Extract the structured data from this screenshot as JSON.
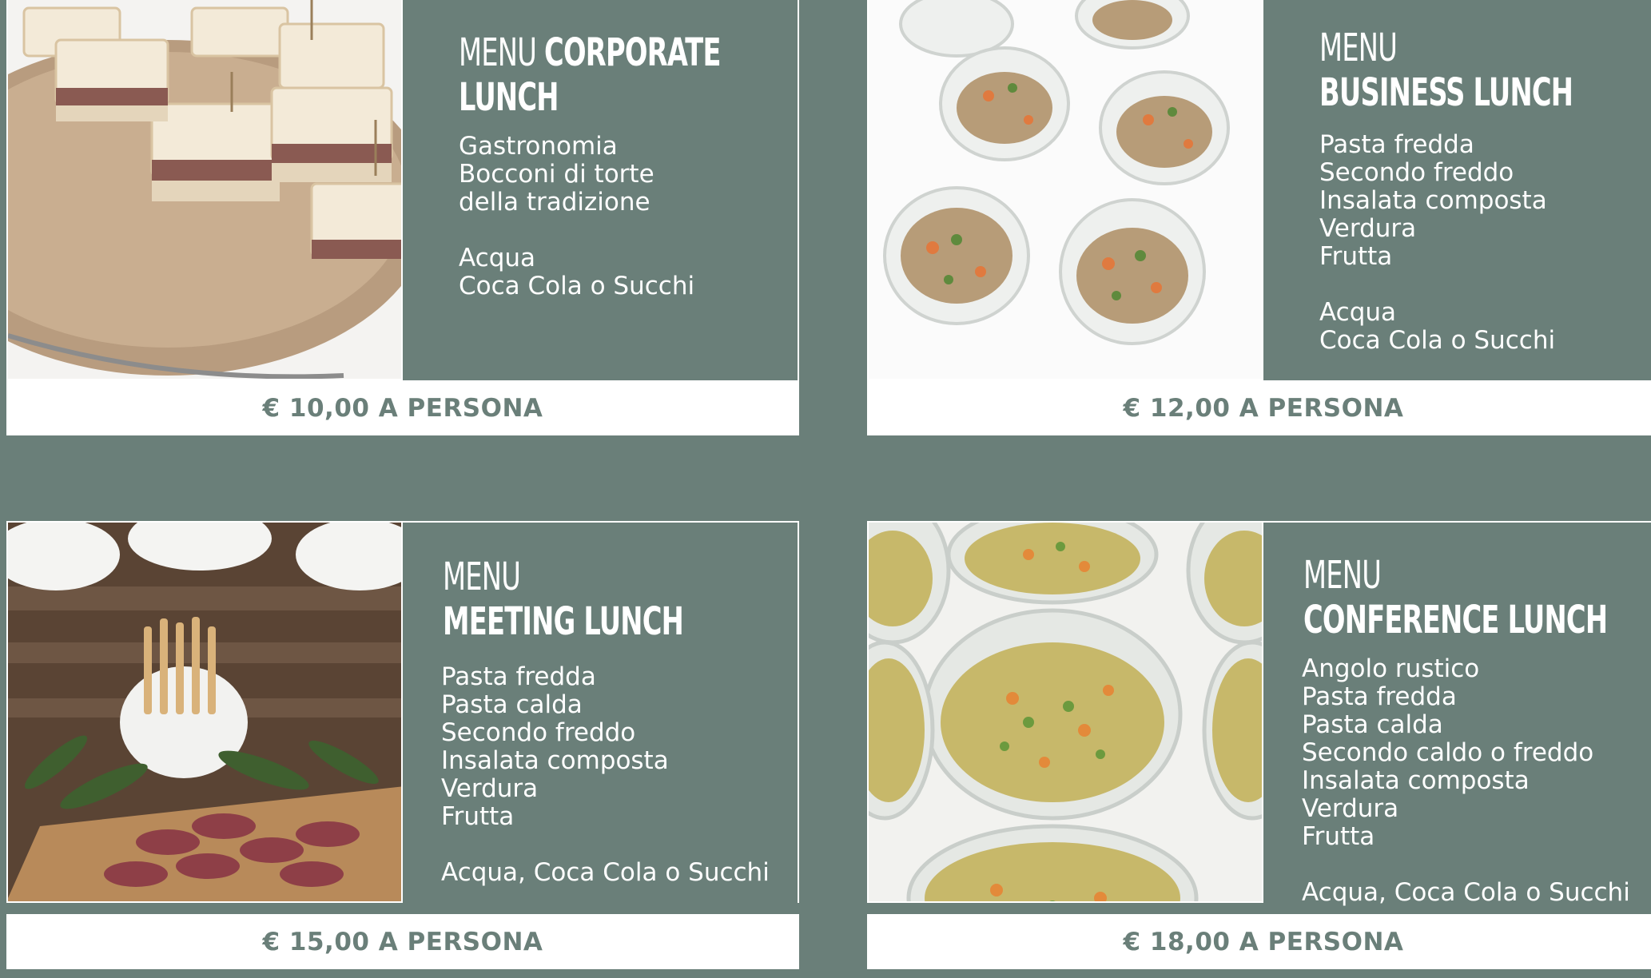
{
  "menus": [
    {
      "title_light": "MENU",
      "title_bold": "CORPORATE",
      "title_bold_2": "LUNCH",
      "food": [
        "Gastronomia",
        "Bocconi di torte",
        "della tradizione"
      ],
      "drinks": [
        "Acqua",
        "Coca Cola o Succhi"
      ],
      "price": "€ 10,00 A PERSONA"
    },
    {
      "title_light": "MENU",
      "title_bold": "BUSINESS LUNCH",
      "food": [
        "Pasta fredda",
        "Secondo freddo",
        "Insalata composta",
        "Verdura",
        "Frutta"
      ],
      "drinks": [
        "Acqua",
        "Coca Cola o Succhi"
      ],
      "price": "€ 12,00 A PERSONA"
    },
    {
      "title_light": "MENU",
      "title_bold": "MEETING LUNCH",
      "food": [
        "Pasta fredda",
        "Pasta calda",
        "Secondo freddo",
        "Insalata composta",
        "Verdura",
        "Frutta"
      ],
      "drinks": [
        "Acqua, Coca Cola o Succhi"
      ],
      "price": "€ 15,00 A PERSONA"
    },
    {
      "title_light": "MENU",
      "title_bold": "CONFERENCE LUNCH",
      "food": [
        "Angolo rustico",
        "Pasta fredda",
        "Pasta calda",
        "Secondo caldo o freddo",
        "Insalata composta",
        "Verdura",
        "Frutta"
      ],
      "drinks": [
        "Acqua, Coca Cola o Succhi"
      ],
      "price": "€ 18,00 A PERSONA"
    }
  ],
  "colors": {
    "background": "#6a7f79",
    "panel": "#6a7f79",
    "price_bar": "#ffffff",
    "price_text": "#6a7f79"
  }
}
